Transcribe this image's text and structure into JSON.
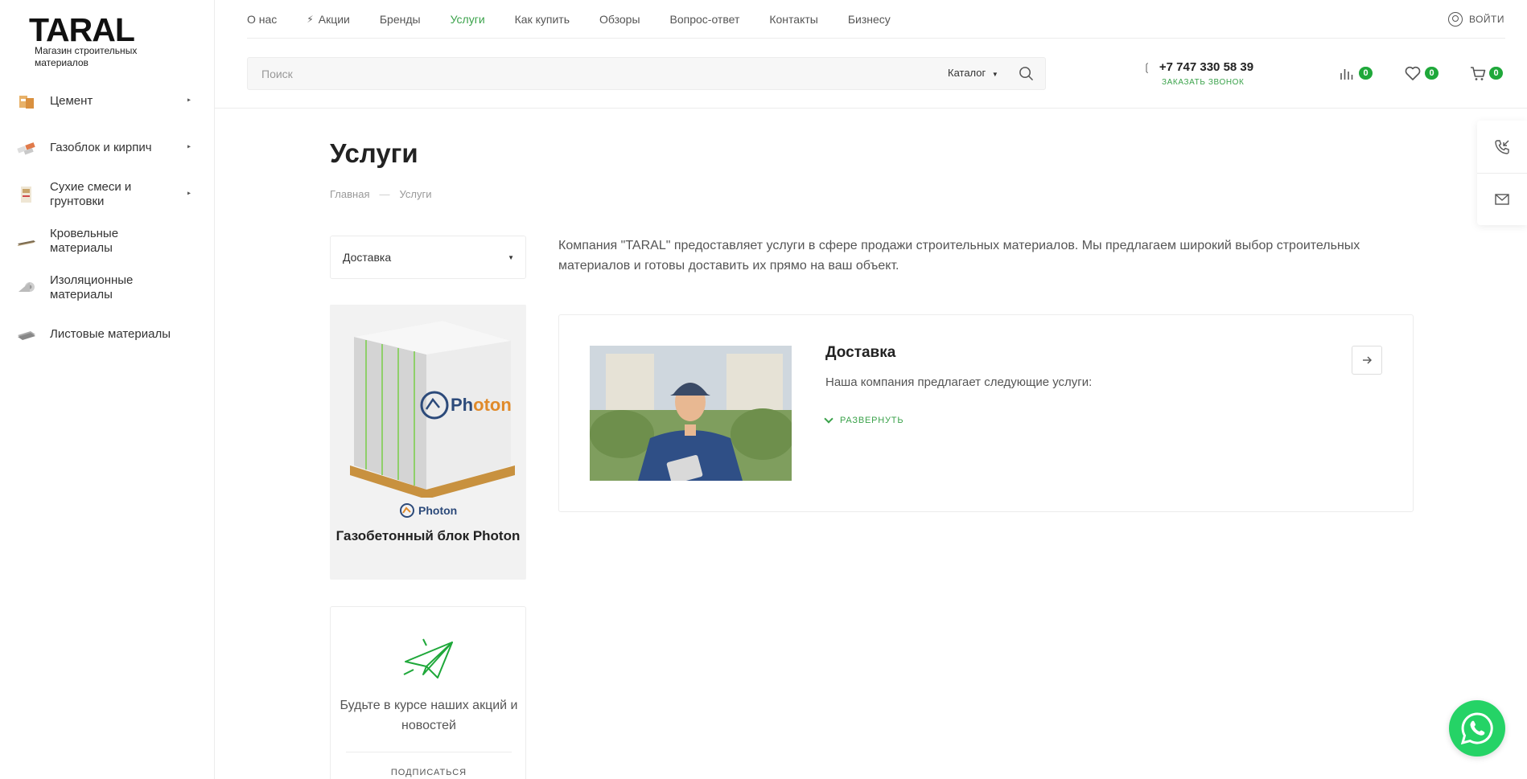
{
  "logo": {
    "title": "TARAL",
    "subtitle": "Магазин строительных материалов"
  },
  "sidebar": {
    "categories": [
      {
        "label": "Цемент",
        "has_children": true,
        "icon": "cement-bag-icon"
      },
      {
        "label": "Газоблок и кирпич",
        "has_children": true,
        "icon": "brick-icon"
      },
      {
        "label": "Сухие смеси и грунтовки",
        "has_children": true,
        "icon": "dry-mix-bag-icon"
      },
      {
        "label": "Кровельные материалы",
        "has_children": false,
        "icon": "roofing-icon"
      },
      {
        "label": "Изоляционные материалы",
        "has_children": false,
        "icon": "insulation-roll-icon"
      },
      {
        "label": "Листовые материалы",
        "has_children": false,
        "icon": "sheet-icon"
      }
    ]
  },
  "topnav": {
    "items": [
      {
        "label": "О нас",
        "active": false
      },
      {
        "label": "Акции",
        "active": false,
        "icon": "bolt-icon"
      },
      {
        "label": "Бренды",
        "active": false
      },
      {
        "label": "Услуги",
        "active": true
      },
      {
        "label": "Как купить",
        "active": false
      },
      {
        "label": "Обзоры",
        "active": false
      },
      {
        "label": "Вопрос-ответ",
        "active": false
      },
      {
        "label": "Контакты",
        "active": false
      },
      {
        "label": "Бизнесу",
        "active": false
      }
    ],
    "login_label": "ВОЙТИ"
  },
  "search": {
    "placeholder": "Поиск",
    "category_label": "Каталог"
  },
  "contacts": {
    "phone": "+7 747 330 58 39",
    "callback_label": "ЗАКАЗАТЬ ЗВОНОК"
  },
  "header_icons": {
    "compare_count": "0",
    "favorites_count": "0",
    "cart_count": "0"
  },
  "page": {
    "title": "Услуги",
    "breadcrumb": {
      "home": "Главная",
      "current": "Услуги"
    },
    "filter_select": {
      "value": "Доставка"
    },
    "intro": "Компания \"TARAL\" предоставляет услуги в сфере продажи строительных материалов. Мы предлагаем широкий выбор строительных материалов и готовы доставить их прямо на ваш объект."
  },
  "promo": {
    "brand": "Photon",
    "title": "Газобетонный блок Photon"
  },
  "subscribe": {
    "text": "Будьте в курсе наших акций и новостей",
    "button_label": "ПОДПИСАТЬСЯ"
  },
  "service": {
    "title": "Доставка",
    "description": "Наша компания предлагает следующие услуги:",
    "expand_label": "РАЗВЕРНУТЬ"
  },
  "colors": {
    "accent": "#3aa24a",
    "badge": "#1fa83a",
    "whatsapp": "#25d366"
  }
}
